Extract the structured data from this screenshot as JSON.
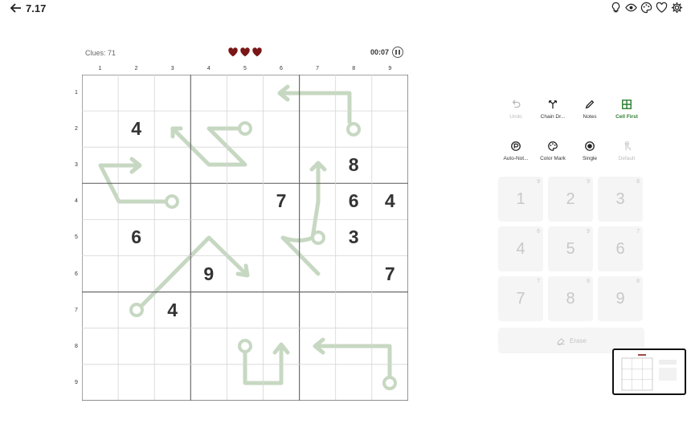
{
  "header": {
    "title": "7.17",
    "back_icon": "arrow-left-icon",
    "icons": [
      "lightbulb-icon",
      "eye-icon",
      "palette-icon",
      "heart-icon",
      "gear-icon"
    ]
  },
  "status": {
    "clues": "Clues: 71",
    "lives": 3,
    "timer": "00:07"
  },
  "colors": {
    "heart": "#7a1616",
    "arrow": "#c7d8c2",
    "grid_thin": "#d6d6d6",
    "grid_thick": "#6b6b6b",
    "active_tool": "#2e7d32"
  },
  "grid": {
    "col_labels": [
      "1",
      "2",
      "3",
      "4",
      "5",
      "6",
      "7",
      "8",
      "9"
    ],
    "row_labels": [
      "1",
      "2",
      "3",
      "4",
      "5",
      "6",
      "7",
      "8",
      "9"
    ],
    "cells": [
      [
        "",
        "",
        "",
        "",
        "",
        "",
        "",
        "",
        ""
      ],
      [
        "",
        "4",
        "",
        "",
        "",
        "",
        "",
        "",
        ""
      ],
      [
        "",
        "",
        "",
        "",
        "",
        "",
        "",
        "8",
        ""
      ],
      [
        "",
        "",
        "",
        "",
        "",
        "7",
        "",
        "6",
        "4"
      ],
      [
        "",
        "6",
        "",
        "",
        "",
        "",
        "",
        "3",
        ""
      ],
      [
        "",
        "",
        "",
        "9",
        "",
        "",
        "",
        "",
        "7"
      ],
      [
        "",
        "",
        "4",
        "",
        "",
        "",
        "",
        "",
        ""
      ],
      [
        "",
        "",
        "",
        "",
        "",
        "",
        "",
        "",
        ""
      ],
      [
        "",
        "",
        "",
        "",
        "",
        "",
        "",
        "",
        ""
      ]
    ]
  },
  "tools": [
    {
      "label": "Undo",
      "icon": "undo-icon"
    },
    {
      "label": "Chain Dr...",
      "icon": "chain-icon"
    },
    {
      "label": "Notes",
      "icon": "pencil-icon"
    },
    {
      "label": "Cell First",
      "icon": "grid-icon"
    },
    {
      "label": "Auto-Not...",
      "icon": "auto-notes-icon"
    },
    {
      "label": "Color Mark",
      "icon": "palette-icon"
    },
    {
      "label": "Single",
      "icon": "radio-icon"
    },
    {
      "label": "Default",
      "icon": "touch-icon"
    }
  ],
  "numpad": [
    {
      "digit": "1",
      "count": "9"
    },
    {
      "digit": "2",
      "count": "9"
    },
    {
      "digit": "3",
      "count": "8"
    },
    {
      "digit": "4",
      "count": "6"
    },
    {
      "digit": "5",
      "count": "9"
    },
    {
      "digit": "6",
      "count": "7"
    },
    {
      "digit": "7",
      "count": "7"
    },
    {
      "digit": "8",
      "count": "8"
    },
    {
      "digit": "9",
      "count": "8"
    }
  ],
  "erase_label": "Erase"
}
